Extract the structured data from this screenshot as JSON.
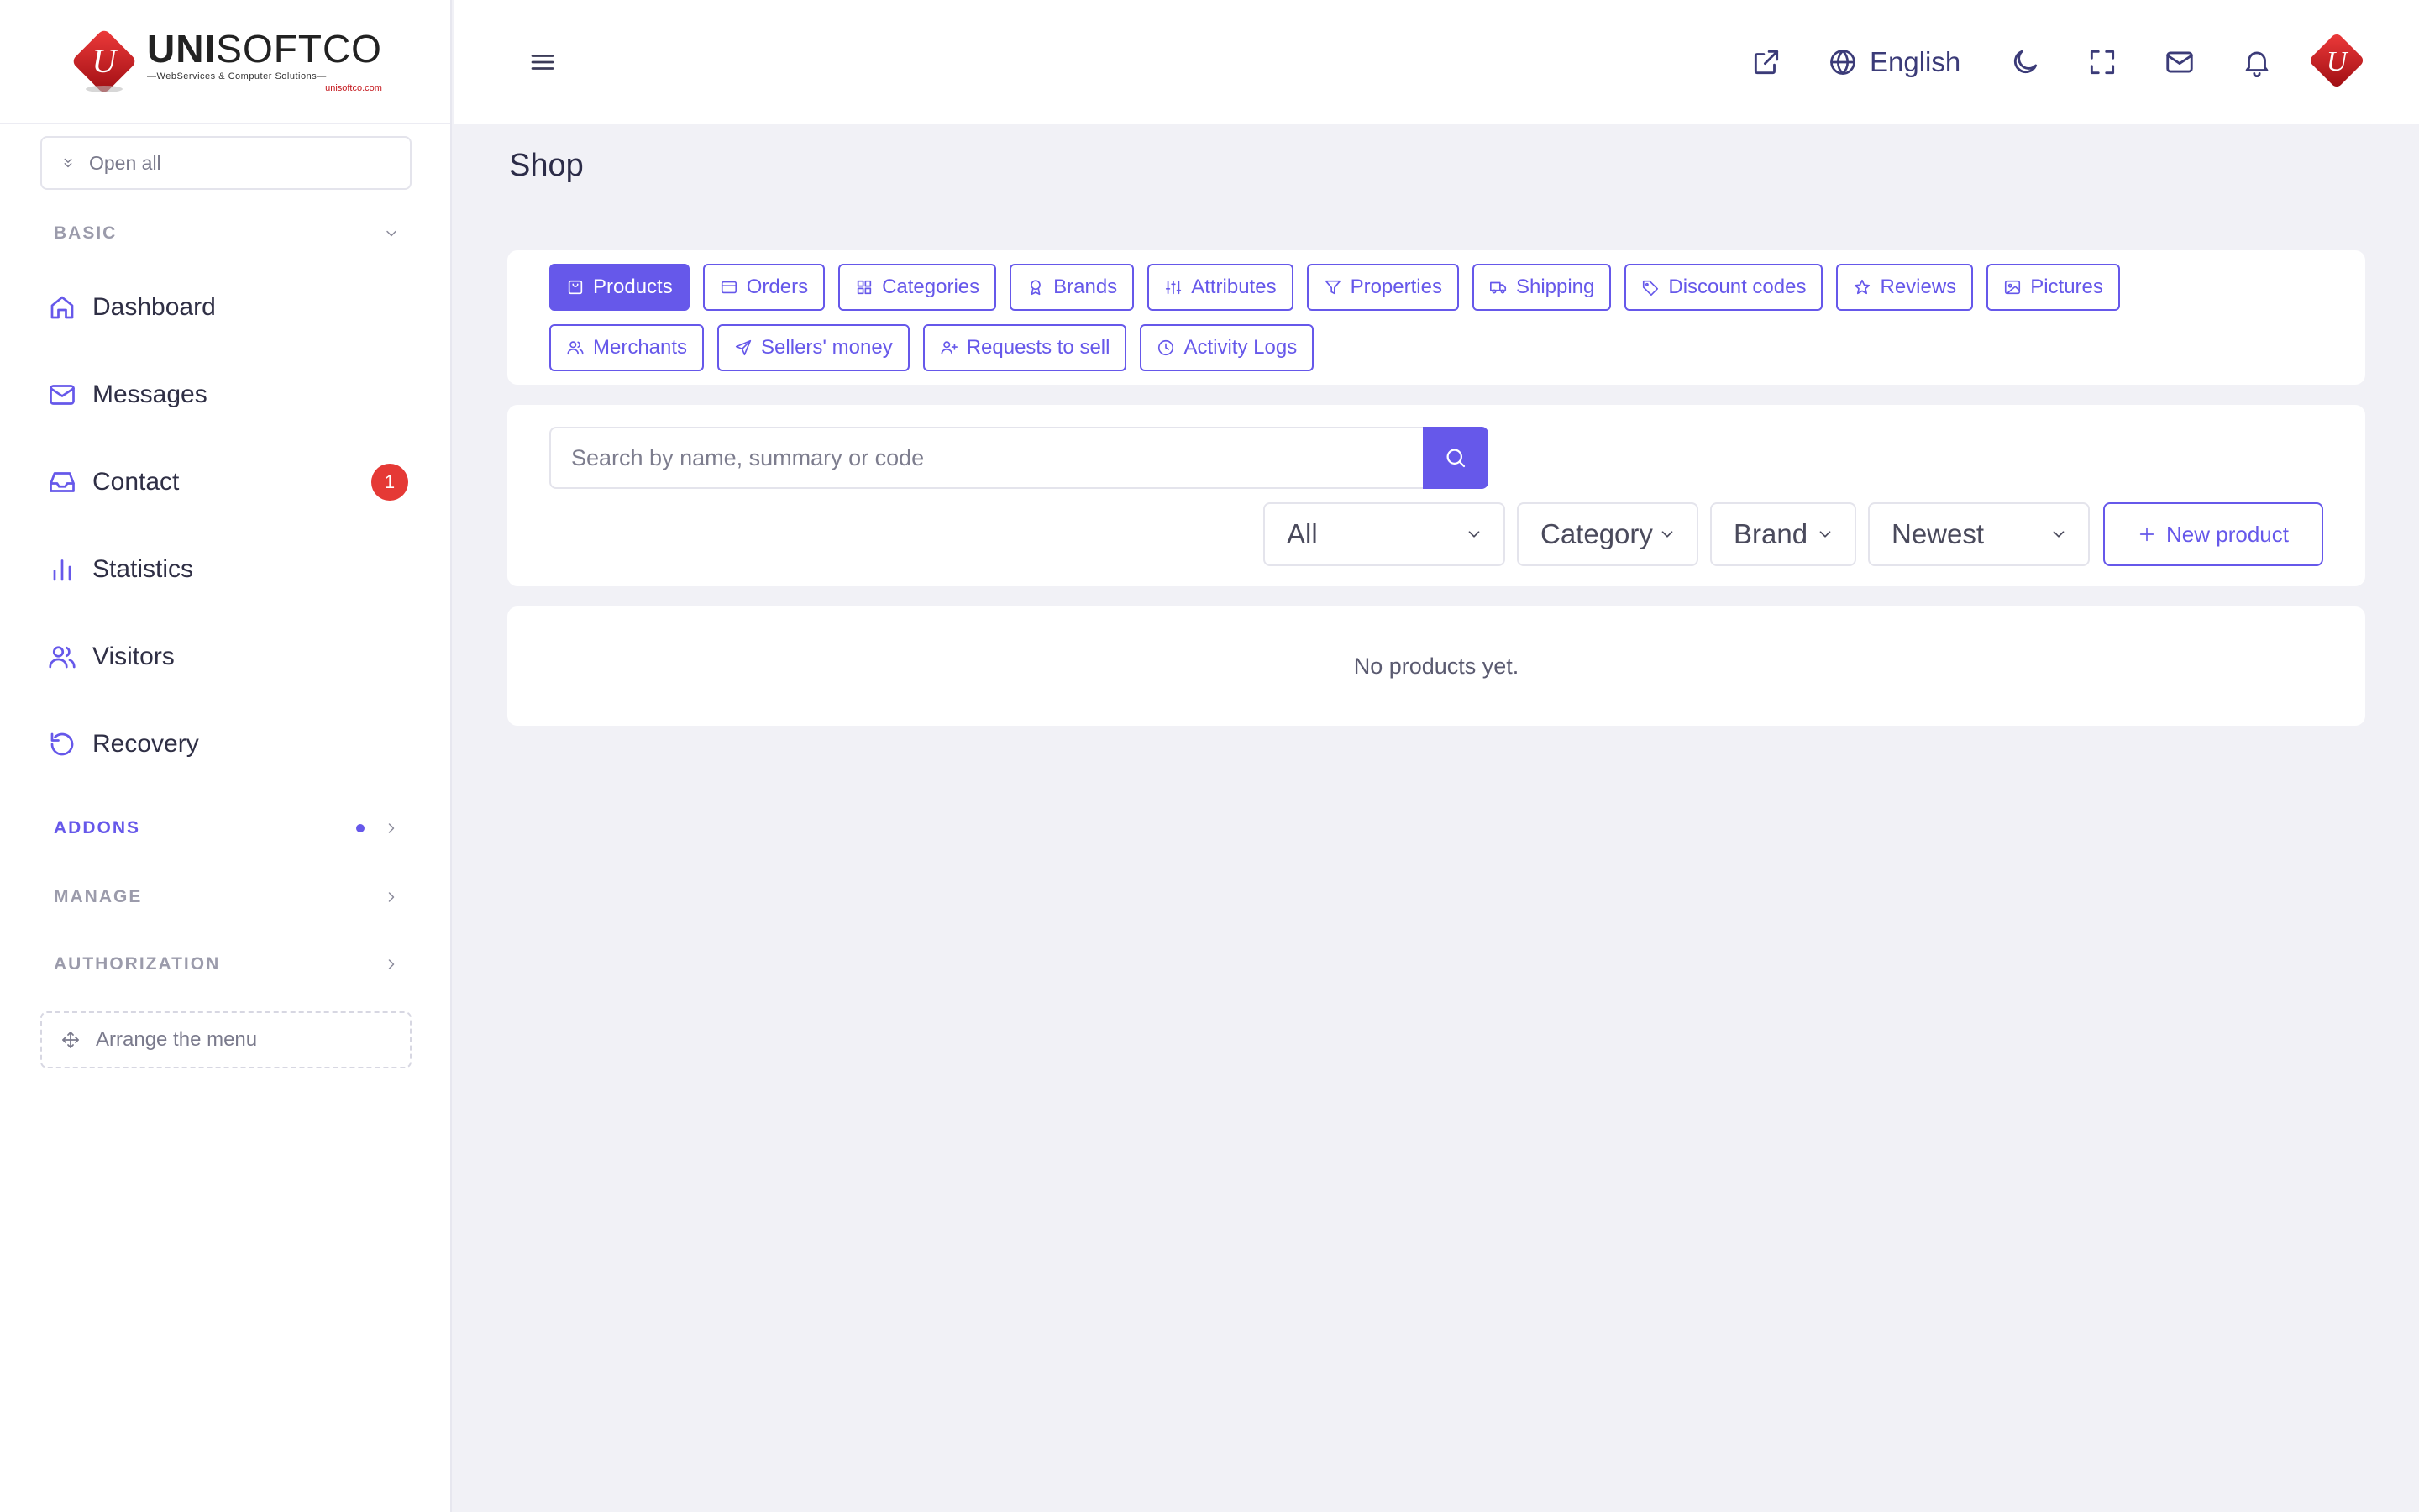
{
  "brand": {
    "logo_letter": "U",
    "name_bold": "UNI",
    "name_light": "SOFTCO",
    "tagline": "—WebServices & Computer Solutions—",
    "url": "unisoftco.com"
  },
  "sidebar": {
    "open_all": "Open all",
    "sections": {
      "basic": "BASIC",
      "addons": "ADDONS",
      "manage": "MANAGE",
      "authorization": "AUTHORIZATION"
    },
    "items": [
      {
        "label": "Dashboard",
        "icon": "home-icon"
      },
      {
        "label": "Messages",
        "icon": "envelope-icon"
      },
      {
        "label": "Contact",
        "icon": "inbox-icon",
        "badge": "1"
      },
      {
        "label": "Statistics",
        "icon": "bar-chart-icon"
      },
      {
        "label": "Visitors",
        "icon": "users-icon"
      },
      {
        "label": "Recovery",
        "icon": "history-icon"
      }
    ],
    "arrange_menu": "Arrange the menu"
  },
  "topbar": {
    "language": "English"
  },
  "page": {
    "title": "Shop"
  },
  "tabs": [
    {
      "label": "Products",
      "icon": "shopping-bag-icon",
      "active": true
    },
    {
      "label": "Orders",
      "icon": "credit-card-icon"
    },
    {
      "label": "Categories",
      "icon": "grid-icon"
    },
    {
      "label": "Brands",
      "icon": "award-icon"
    },
    {
      "label": "Attributes",
      "icon": "sliders-icon"
    },
    {
      "label": "Properties",
      "icon": "filter-icon"
    },
    {
      "label": "Shipping",
      "icon": "truck-icon"
    },
    {
      "label": "Discount codes",
      "icon": "tag-icon"
    },
    {
      "label": "Reviews",
      "icon": "star-icon"
    },
    {
      "label": "Pictures",
      "icon": "image-icon"
    },
    {
      "label": "Merchants",
      "icon": "users-icon"
    },
    {
      "label": "Sellers' money",
      "icon": "send-icon"
    },
    {
      "label": "Requests to sell",
      "icon": "user-plus-icon"
    },
    {
      "label": "Activity Logs",
      "icon": "clock-icon"
    }
  ],
  "filters": {
    "search_placeholder": "Search by name, summary or code",
    "status": "All",
    "category": "Category",
    "brand": "Brand",
    "sort": "Newest",
    "new_product": "New product"
  },
  "empty_state": "No products yet.",
  "colors": {
    "accent": "#6658ea",
    "badge": "#e53935",
    "background": "#f1f1f6"
  }
}
